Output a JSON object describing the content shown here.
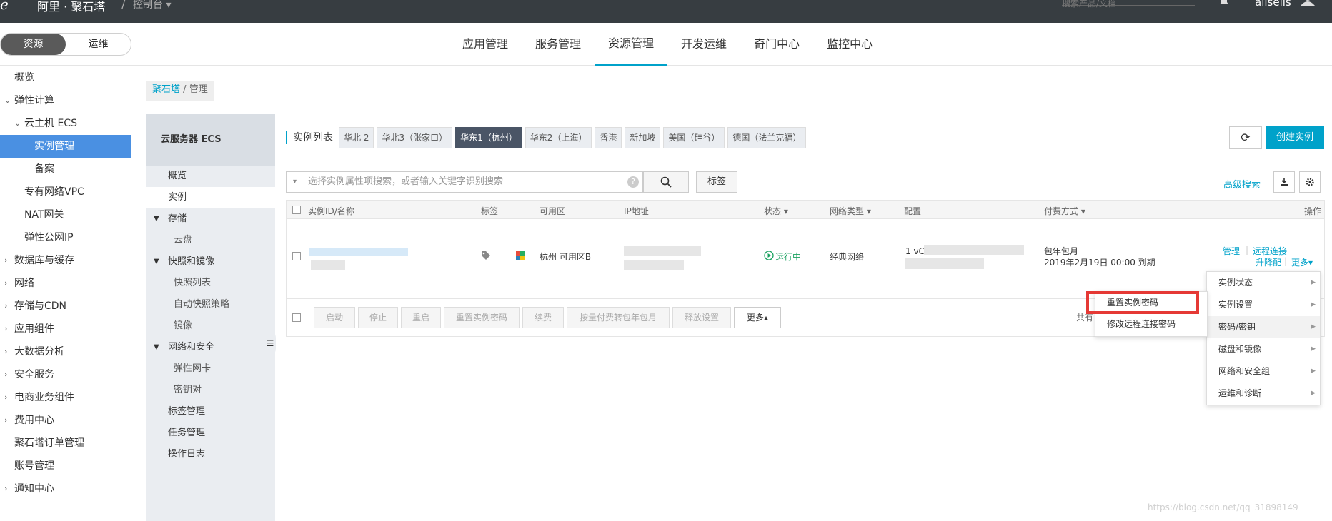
{
  "topbar": {
    "logo_mark": "e",
    "product": "阿里 · 聚石塔",
    "separator": "/",
    "console": "控制台 ▾",
    "search_placeholder": "搜索产品/文档",
    "user": "allsells"
  },
  "nav": {
    "switch": [
      "资源",
      "运维"
    ],
    "tabs": [
      "应用管理",
      "服务管理",
      "资源管理",
      "开发运维",
      "奇门中心",
      "监控中心"
    ]
  },
  "left_menu": [
    {
      "label": "概览",
      "level": 0,
      "chevron": ""
    },
    {
      "label": "弹性计算",
      "level": 0,
      "chevron": "⌄"
    },
    {
      "label": "云主机 ECS",
      "level": 1,
      "chevron": "⌄"
    },
    {
      "label": "实例管理",
      "level": 2,
      "chevron": "",
      "selected": true
    },
    {
      "label": "备案",
      "level": 2,
      "chevron": ""
    },
    {
      "label": "专有网络VPC",
      "level": 1,
      "chevron": ""
    },
    {
      "label": "NAT网关",
      "level": 1,
      "chevron": ""
    },
    {
      "label": "弹性公网IP",
      "level": 1,
      "chevron": ""
    },
    {
      "label": "数据库与缓存",
      "level": 0,
      "chevron": "›"
    },
    {
      "label": "网络",
      "level": 0,
      "chevron": "›"
    },
    {
      "label": "存储与CDN",
      "level": 0,
      "chevron": "›"
    },
    {
      "label": "应用组件",
      "level": 0,
      "chevron": "›"
    },
    {
      "label": "大数据分析",
      "level": 0,
      "chevron": "›"
    },
    {
      "label": "安全服务",
      "level": 0,
      "chevron": "›"
    },
    {
      "label": "电商业务组件",
      "level": 0,
      "chevron": "›"
    },
    {
      "label": "费用中心",
      "level": 0,
      "chevron": "›"
    },
    {
      "label": "聚石塔订单管理",
      "level": 0,
      "chevron": ""
    },
    {
      "label": "账号管理",
      "level": 0,
      "chevron": ""
    },
    {
      "label": "通知中心",
      "level": 0,
      "chevron": "›"
    }
  ],
  "breadcrumb": {
    "link": "聚石塔",
    "sep": "/",
    "current": "管理"
  },
  "midnav": {
    "head": "云服务器 ECS",
    "items": [
      {
        "label": "概览",
        "type": "top"
      },
      {
        "label": "实例",
        "type": "top",
        "active": true
      },
      {
        "label": "存储",
        "type": "group"
      },
      {
        "label": "云盘",
        "type": "child"
      },
      {
        "label": "快照和镜像",
        "type": "group"
      },
      {
        "label": "快照列表",
        "type": "child"
      },
      {
        "label": "自动快照策略",
        "type": "child"
      },
      {
        "label": "镜像",
        "type": "child"
      },
      {
        "label": "网络和安全",
        "type": "group"
      },
      {
        "label": "弹性网卡",
        "type": "child"
      },
      {
        "label": "密钥对",
        "type": "child"
      },
      {
        "label": "标签管理",
        "type": "top"
      },
      {
        "label": "任务管理",
        "type": "top"
      },
      {
        "label": "操作日志",
        "type": "top"
      }
    ],
    "collapse": "☰"
  },
  "regions": {
    "label": "实例列表",
    "list": [
      "华北 2",
      "华北3（张家口）",
      "华东1（杭州）",
      "华东2（上海）",
      "香港",
      "新加坡",
      "美国（硅谷）",
      "德国（法兰克福）"
    ],
    "active_index": 2
  },
  "actions": {
    "refresh": "⟳",
    "create": "创建实例"
  },
  "search": {
    "placeholder": "选择实例属性项搜索，或者输入关键字识别搜索",
    "help": "?",
    "tag": "标签",
    "advanced": "高级搜索"
  },
  "table": {
    "headers": [
      "实例ID/名称",
      "标签",
      "可用区",
      "IP地址",
      "状态 ▾",
      "网络类型 ▾",
      "配置",
      "付费方式 ▾",
      "操作"
    ],
    "row": {
      "zone": "杭州 可用区B",
      "status": "运行中",
      "network": "经典网络",
      "config_prefix": "1 vC",
      "pay_type": "包年包月",
      "expire": "2019年2月19日 00:00 到期",
      "op_manage": "管理",
      "op_remote": "远程连接",
      "op_upgrade": "升降配",
      "op_more": "更多▾"
    },
    "footer_buttons": [
      "启动",
      "停止",
      "重启",
      "重置实例密码",
      "续费",
      "按量付费转包年包月",
      "释放设置",
      "更多▴"
    ],
    "total": "共有"
  },
  "dropdown": [
    {
      "label": "实例状态"
    },
    {
      "label": "实例设置"
    },
    {
      "label": "密码/密钥",
      "highlight": true
    },
    {
      "label": "磁盘和镜像"
    },
    {
      "label": "网络和安全组"
    },
    {
      "label": "运维和诊断"
    }
  ],
  "submenu": [
    "重置实例密码",
    "修改远程连接密码"
  ],
  "watermark": "https://blog.csdn.net/qq_31898149"
}
